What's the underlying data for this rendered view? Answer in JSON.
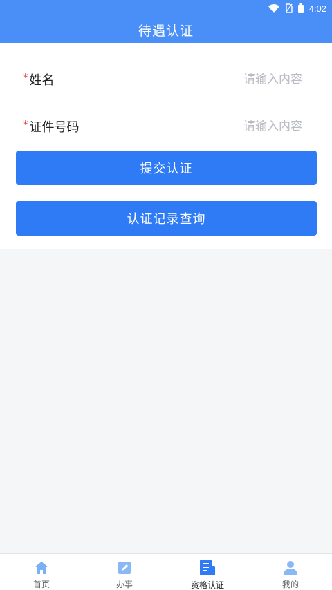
{
  "status_bar": {
    "time": "4:02"
  },
  "header": {
    "title": "待遇认证"
  },
  "form": {
    "fields": [
      {
        "required_mark": "*",
        "label": "姓名",
        "value": "",
        "placeholder": "请输入内容"
      },
      {
        "required_mark": "*",
        "label": "证件号码",
        "value": "",
        "placeholder": "请输入内容"
      }
    ],
    "submit_label": "提交认证",
    "query_label": "认证记录查询"
  },
  "tab_bar": {
    "items": [
      {
        "label": "首页",
        "icon": "home-icon"
      },
      {
        "label": "办事",
        "icon": "edit-icon"
      },
      {
        "label": "资格认证",
        "icon": "document-icon",
        "active": true
      },
      {
        "label": "我的",
        "icon": "user-icon"
      }
    ]
  },
  "colors": {
    "header_blue": "#4a8ff7",
    "button_blue": "#2f7bf6",
    "tab_icon_blue": "#7ab0f5",
    "tab_active_blue": "#2f7bf6",
    "required_red": "#e53935",
    "background": "#f5f6f8"
  }
}
